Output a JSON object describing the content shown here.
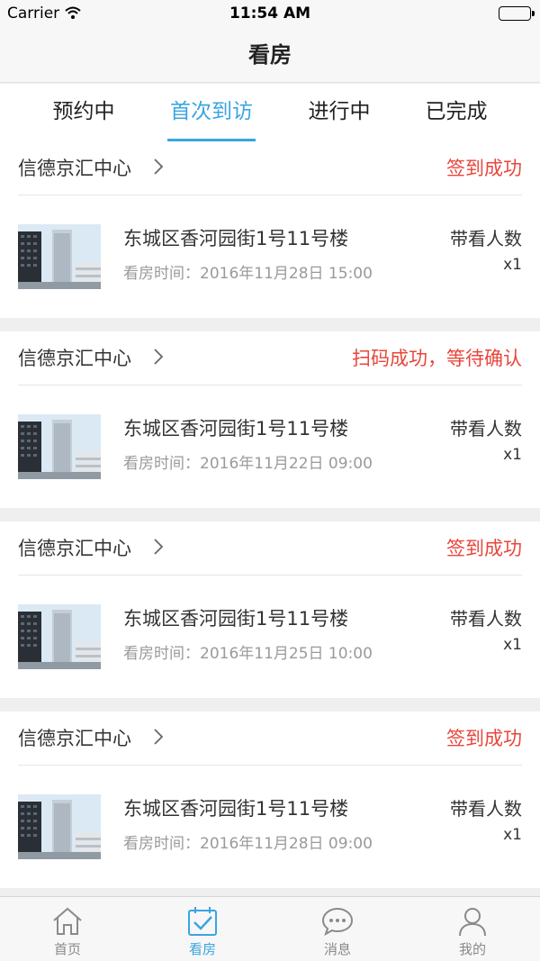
{
  "status_bar": {
    "carrier": "Carrier",
    "time": "11:54 AM"
  },
  "nav": {
    "title": "看房"
  },
  "tabs": [
    {
      "label": "预约中",
      "active": false
    },
    {
      "label": "首次到访",
      "active": true
    },
    {
      "label": "进行中",
      "active": false
    },
    {
      "label": "已完成",
      "active": false
    }
  ],
  "colors": {
    "accent": "#3aa5e0",
    "status_red": "#e8463c"
  },
  "cards": [
    {
      "center": "信德京汇中心",
      "status": "签到成功",
      "address": "东城区香河园街1号11号楼",
      "visit_time": "看房时间：2016年11月28日 15:00",
      "count_label": "带看人数",
      "count": "x1"
    },
    {
      "center": "信德京汇中心",
      "status": "扫码成功，等待确认",
      "address": "东城区香河园街1号11号楼",
      "visit_time": "看房时间：2016年11月22日 09:00",
      "count_label": "带看人数",
      "count": "x1"
    },
    {
      "center": "信德京汇中心",
      "status": "签到成功",
      "address": "东城区香河园街1号11号楼",
      "visit_time": "看房时间：2016年11月25日 10:00",
      "count_label": "带看人数",
      "count": "x1"
    },
    {
      "center": "信德京汇中心",
      "status": "签到成功",
      "address": "东城区香河园街1号11号楼",
      "visit_time": "看房时间：2016年11月28日 09:00",
      "count_label": "带看人数",
      "count": "x1"
    }
  ],
  "tabbar": [
    {
      "label": "首页",
      "icon": "home-icon",
      "active": false
    },
    {
      "label": "看房",
      "icon": "calendar-check-icon",
      "active": true
    },
    {
      "label": "消息",
      "icon": "chat-bubble-icon",
      "active": false
    },
    {
      "label": "我的",
      "icon": "person-icon",
      "active": false
    }
  ]
}
